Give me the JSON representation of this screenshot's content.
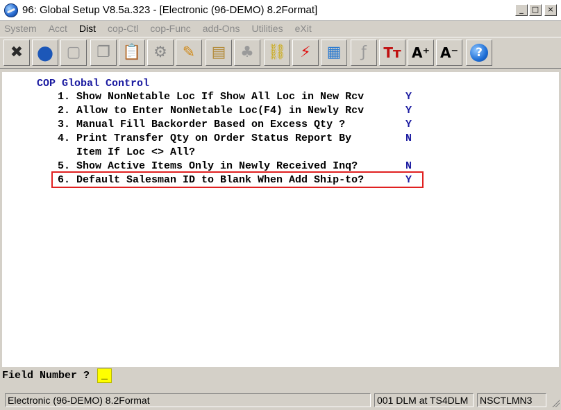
{
  "window": {
    "title": "96: Global Setup V8.5a.323 - [Electronic (96-DEMO) 8.2Format]",
    "controls": {
      "minimize": "_",
      "maximize": "□",
      "close": "×"
    }
  },
  "menu": [
    {
      "label": "System",
      "enabled": false
    },
    {
      "label": "Acct",
      "enabled": false
    },
    {
      "label": "Dist",
      "enabled": true
    },
    {
      "label": "cop-Ctl",
      "enabled": false
    },
    {
      "label": "cop-Func",
      "enabled": false
    },
    {
      "label": "add-Ons",
      "enabled": false
    },
    {
      "label": "Utilities",
      "enabled": false
    },
    {
      "label": "eXit",
      "enabled": false
    }
  ],
  "toolbar": [
    {
      "name": "exit-icon",
      "glyph": "✖",
      "color": "#2a2a2a"
    },
    {
      "name": "globe-icon",
      "glyph": "●",
      "color": "#1c57b8"
    },
    {
      "name": "blank-page-icon",
      "glyph": "▢",
      "color": "#9a9a9a"
    },
    {
      "name": "copy-icon",
      "glyph": "❐",
      "color": "#8a8a8a"
    },
    {
      "name": "paste-icon",
      "glyph": "📋",
      "color": "#8a8a8a"
    },
    {
      "name": "settings-icon",
      "glyph": "⚙",
      "color": "#8a8a8a"
    },
    {
      "name": "edit-icon",
      "glyph": "✎",
      "color": "#d08a1a"
    },
    {
      "name": "notes-icon",
      "glyph": "▤",
      "color": "#b38b3a"
    },
    {
      "name": "users-icon",
      "glyph": "♣",
      "color": "#9a9a9a"
    },
    {
      "name": "link-icon",
      "glyph": "⛓",
      "color": "#c8a500"
    },
    {
      "name": "lightning-icon",
      "glyph": "⚡",
      "color": "#e01010"
    },
    {
      "name": "calendar-icon",
      "glyph": "▦",
      "color": "#2a7ad0"
    },
    {
      "name": "function-icon",
      "glyph": "ƒ",
      "color": "#9a9a9a"
    },
    {
      "name": "font-type-icon",
      "glyph": "Tт",
      "color": "#c01010"
    },
    {
      "name": "font-increase-icon",
      "glyph": "A⁺",
      "color": "#000000"
    },
    {
      "name": "font-decrease-icon",
      "glyph": "A⁻",
      "color": "#000000"
    },
    {
      "name": "help-icon",
      "glyph": "?",
      "color": "#ffffff"
    }
  ],
  "screen": {
    "heading": "COP Global Control",
    "options": [
      {
        "text": "1. Show NonNetable Loc If Show All Loc in New Rcv",
        "value": "Y"
      },
      {
        "text": "2. Allow to Enter NonNetable Loc(F4) in Newly Rcv",
        "value": "Y"
      },
      {
        "text": "3. Manual Fill Backorder Based on Excess Qty ?",
        "value": "Y"
      },
      {
        "text": "4. Print Transfer Qty on Order Status Report By",
        "value": "N"
      },
      {
        "text": "   Item If Loc <> All?",
        "value": ""
      },
      {
        "text": "5. Show Active Items Only in Newly Received Inq?",
        "value": "N"
      },
      {
        "text": "6. Default Salesman ID to Blank When Add Ship-to?",
        "value": "Y"
      }
    ],
    "highlight_color": "#e02020"
  },
  "prompt": {
    "label": "Field Number ?",
    "value": "_"
  },
  "status": {
    "company": "Electronic (96-DEMO) 8.2Format",
    "user": "001 DLM at TS4DLM",
    "terminal": "NSCTLMN3"
  },
  "colors": {
    "value_text": "#1a1aa0",
    "heading_text": "#1a1aa0",
    "input_bg": "#ffff00",
    "chrome": "#d4d0c8"
  }
}
